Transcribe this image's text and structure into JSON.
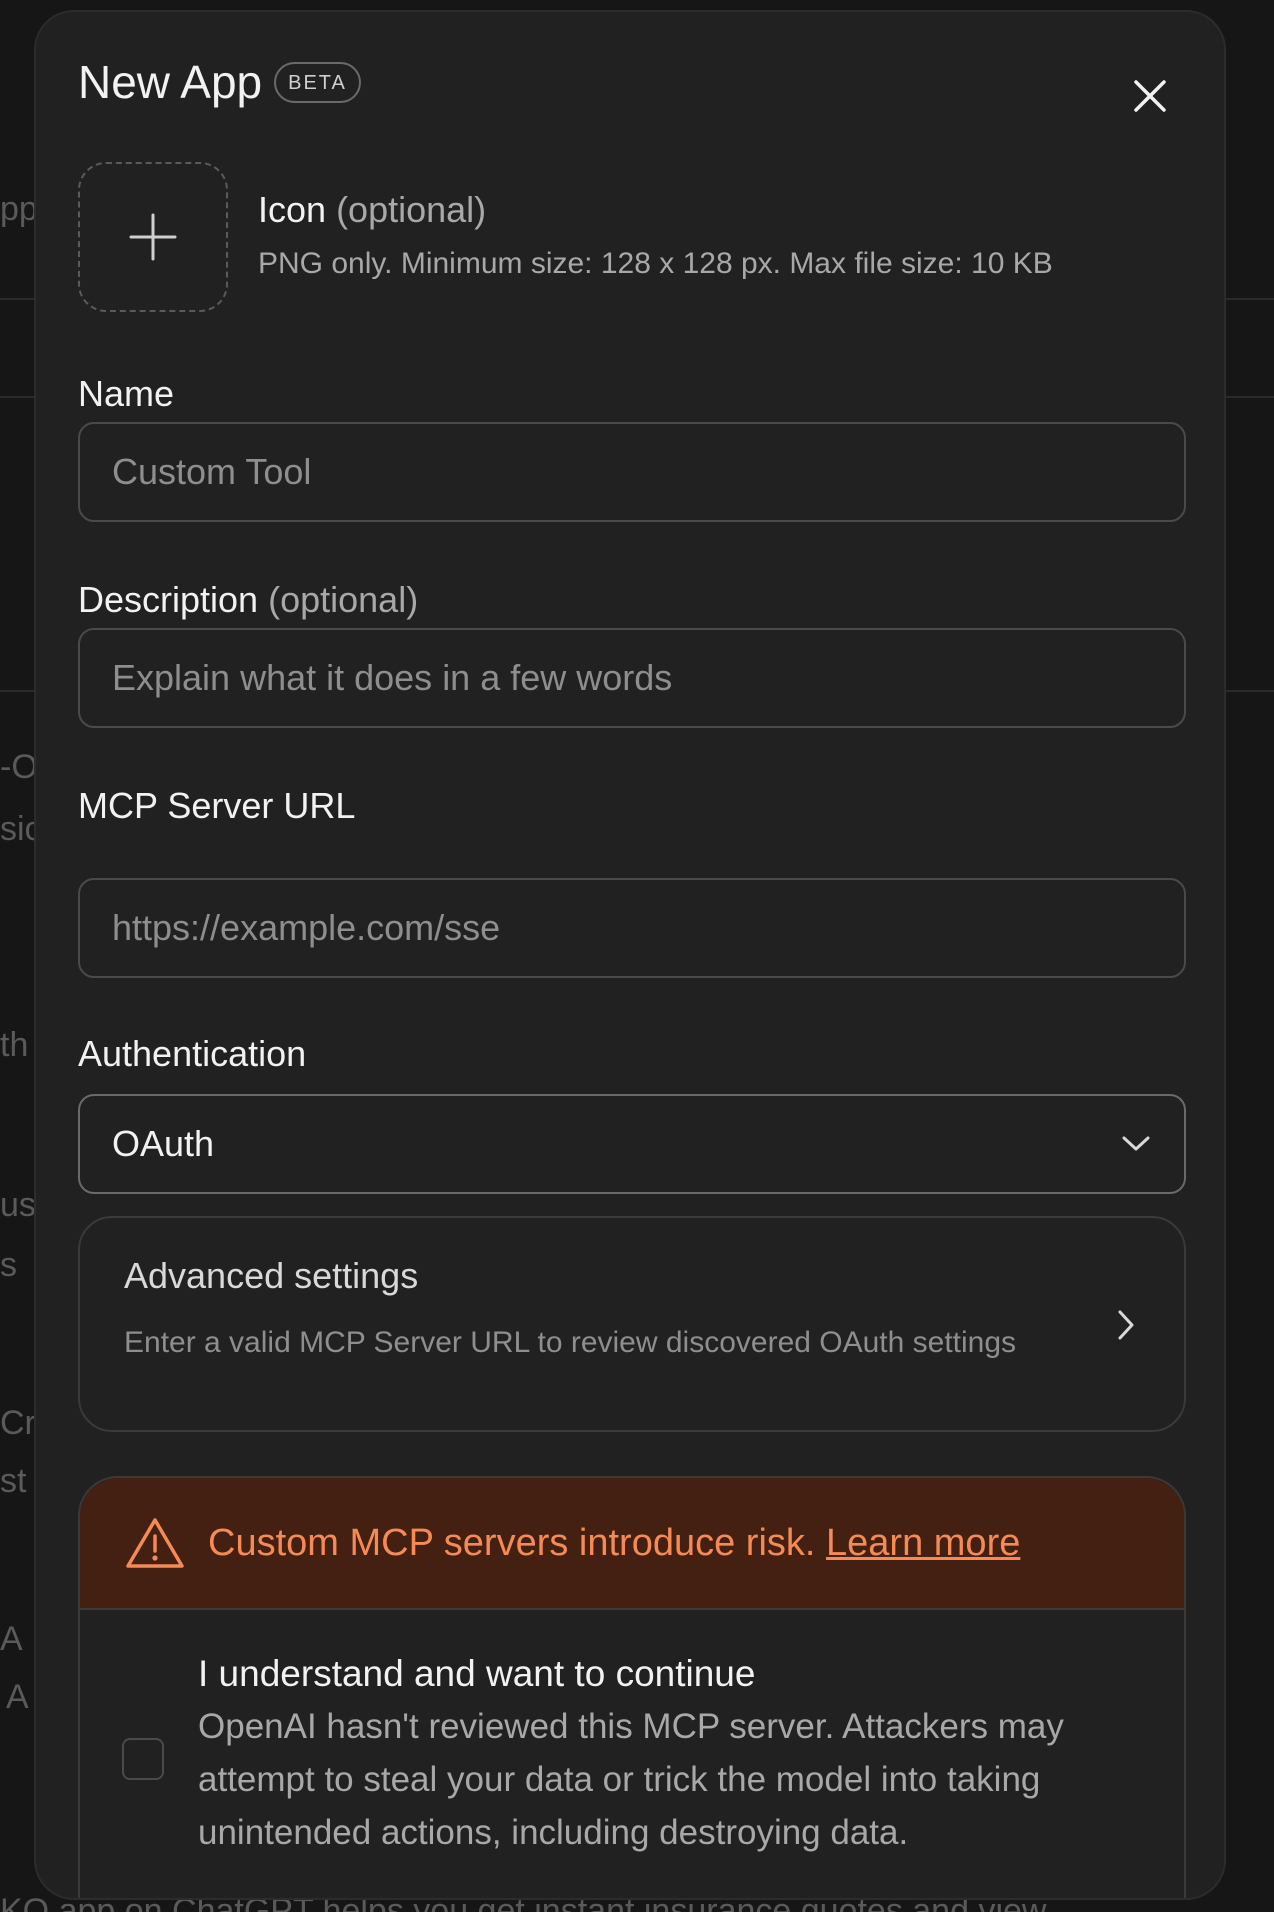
{
  "background": {
    "snippets": [
      "pp",
      "-O",
      "sic",
      "th",
      "us",
      "s",
      "Cro",
      "st",
      "A",
      "A",
      "KO app on ChatGPT helps you get instant insurance quotes and view"
    ]
  },
  "modal": {
    "title": "New App",
    "badge": "BETA",
    "close_icon": "close-icon",
    "icon_field": {
      "label": "Icon",
      "optional": "(optional)",
      "help": "PNG only. Minimum size: 128 x 128 px. Max file size: 10 KB",
      "icon": "plus-icon"
    },
    "name_field": {
      "label": "Name",
      "placeholder": "Custom Tool",
      "value": ""
    },
    "description_field": {
      "label": "Description",
      "optional": "(optional)",
      "placeholder": "Explain what it does in a few words",
      "value": ""
    },
    "url_field": {
      "label": "MCP Server URL",
      "placeholder": "https://example.com/sse",
      "value": ""
    },
    "auth_field": {
      "label": "Authentication",
      "selected": "OAuth",
      "icon": "chevron-down-icon"
    },
    "advanced": {
      "title": "Advanced settings",
      "description": "Enter a valid MCP Server URL to review discovered OAuth settings",
      "icon": "chevron-right-icon"
    },
    "risk": {
      "warning_text": "Custom MCP servers introduce risk.",
      "link_text": "Learn more",
      "icon": "warning-icon",
      "color": "#f58a55",
      "banner_bg": "#432011"
    },
    "consent": {
      "title": "I understand and want to continue",
      "description": "OpenAI hasn't reviewed this MCP server. Attackers may attempt to steal your data or trick the model into taking unintended actions, including destroying data.",
      "checked": false
    }
  }
}
